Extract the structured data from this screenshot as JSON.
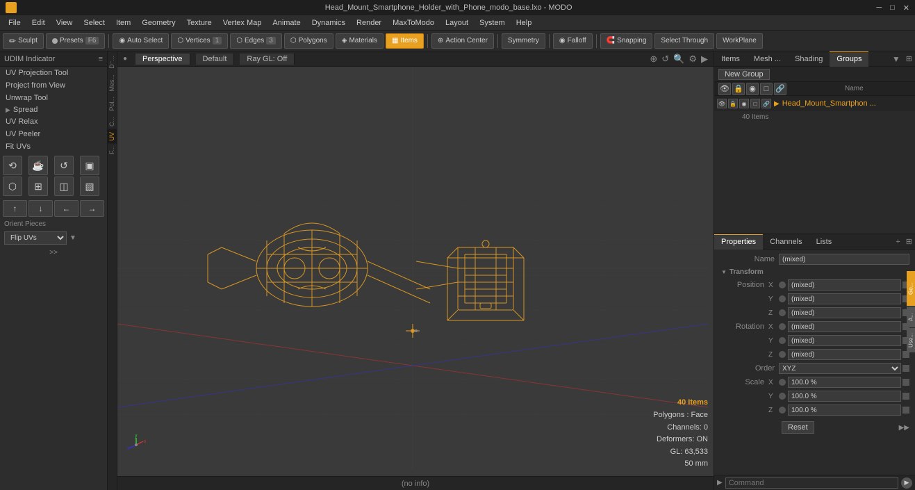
{
  "titlebar": {
    "title": "Head_Mount_Smartphone_Holder_with_Phone_modo_base.lxo - MODO",
    "controls": [
      "─",
      "□",
      "✕"
    ]
  },
  "menubar": {
    "items": [
      "File",
      "Edit",
      "View",
      "Select",
      "Item",
      "Geometry",
      "Texture",
      "Vertex Map",
      "Animate",
      "Dynamics",
      "Render",
      "MaxToModo",
      "Layout",
      "System",
      "Help"
    ]
  },
  "toolbar": {
    "sculpt_label": "Sculpt",
    "presets_label": "Presets",
    "presets_key": "F6",
    "auto_select_label": "Auto Select",
    "vertices_label": "Vertices",
    "vertices_count": "1",
    "edges_label": "Edges",
    "edges_count": "3",
    "polygons_label": "Polygons",
    "materials_label": "Materials",
    "items_label": "Items",
    "action_center_label": "Action Center",
    "symmetry_label": "Symmetry",
    "falloff_label": "Falloff",
    "snapping_label": "Snapping",
    "select_through_label": "Select Through",
    "workplane_label": "WorkPlane"
  },
  "left_panel": {
    "title": "UDIM Indicator",
    "menu_items": [
      "UV Projection Tool",
      "Project from View",
      "Unwrap Tool"
    ],
    "spread_label": "Spread",
    "tools": [
      "UV Relax",
      "UV Peeler"
    ],
    "fit_uvs_label": "Fit UVs",
    "orient_pieces_label": "Orient Pieces",
    "flip_uvs_label": "Flip UVs",
    "expand_label": ">>"
  },
  "viewport": {
    "tabs": [
      "Perspective",
      "Default",
      "Ray GL: Off"
    ],
    "controls": [
      "⊕",
      "↺",
      "🔍",
      "⚙",
      "▶"
    ],
    "overlay_items": "40 Items",
    "overlay_polygons": "Polygons : Face",
    "overlay_channels": "Channels: 0",
    "overlay_deformers": "Deformers: ON",
    "overlay_gl": "GL: 63,533",
    "overlay_size": "50 mm",
    "status": "(no info)"
  },
  "right_panel": {
    "top_tabs": [
      "Items",
      "Mesh ...",
      "Shading",
      "Groups"
    ],
    "active_top_tab": "Groups",
    "new_group_btn": "New Group",
    "col_header_name": "Name",
    "group_item_name": "Head_Mount_Smartphon ...",
    "group_item_count": "40 Items",
    "props_tabs": [
      "Properties",
      "Channels",
      "Lists"
    ],
    "active_props_tab": "Properties",
    "name_label": "Name",
    "name_value": "(mixed)",
    "transform_label": "Transform",
    "position_label": "Position",
    "rotation_label": "Rotation",
    "order_label": "Order",
    "order_value": "XYZ",
    "scale_label": "Scale",
    "reset_label": "Reset",
    "x_label": "X",
    "y_label": "Y",
    "z_label": "Z",
    "mixed_value": "(mixed)",
    "scale_x_value": "100.0 %",
    "scale_y_value": "100.0 %",
    "scale_z_value": "100.0 %"
  },
  "command_bar": {
    "placeholder": "Command"
  },
  "vert_labels": [
    "D⁻...",
    "Mes...",
    "Pol...",
    "C...",
    "UV",
    "F..."
  ]
}
